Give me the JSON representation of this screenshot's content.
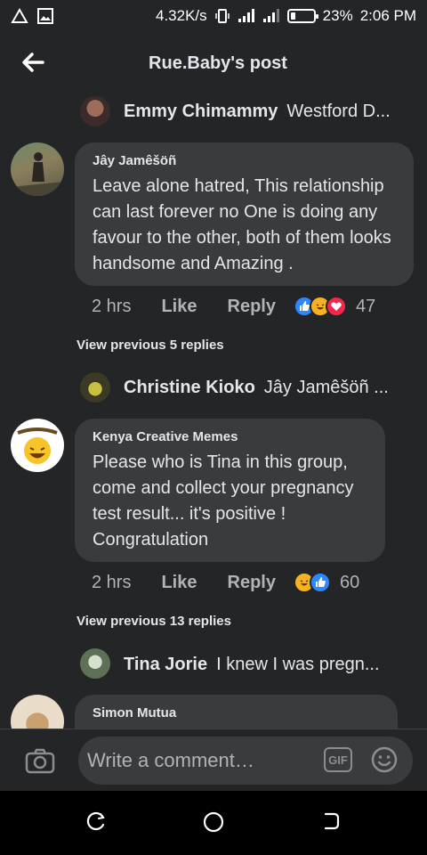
{
  "status_bar": {
    "speed": "4.32K/s",
    "battery_percent": "23%",
    "battery_level": 0.23,
    "time": "2:06 PM"
  },
  "header": {
    "title": "Rue.Baby's post"
  },
  "thread": {
    "reply_1": {
      "name": "Emmy Chimammy",
      "snippet": "Westford D..."
    },
    "comment_1": {
      "author": "Jây Jamêšöñ",
      "text": "Leave alone hatred, This relationship can last forever no One is doing any favour to the other, both of them looks handsome and Amazing .",
      "time": "2 hrs",
      "like_label": "Like",
      "reply_label": "Reply",
      "reaction_count": "47",
      "reactions": [
        "like",
        "haha",
        "love"
      ]
    },
    "view_previous_1": "View previous 5 replies",
    "reply_2": {
      "name": "Christine Kioko",
      "snippet": "Jây Jamêšöñ ..."
    },
    "comment_2": {
      "author": "Kenya Creative Memes",
      "text": "Please who is Tina in this group, come and collect your pregnancy test result... it's positive ! Congratulation",
      "time": "2 hrs",
      "like_label": "Like",
      "reply_label": "Reply",
      "reaction_count": "60",
      "reactions": [
        "haha",
        "like"
      ]
    },
    "view_previous_2": "View previous 13 replies",
    "reply_3": {
      "name": "Tina Jorie",
      "snippet": "I knew I was pregn..."
    },
    "comment_3": {
      "author": "Simon Mutua"
    }
  },
  "composer": {
    "placeholder": "Write a comment…",
    "gif_label": "GIF"
  },
  "colors": {
    "background": "#242526",
    "bubble": "#3a3b3c",
    "text": "#e4e6eb",
    "muted": "#b0b3b8",
    "like_blue": "#2d88ff"
  }
}
